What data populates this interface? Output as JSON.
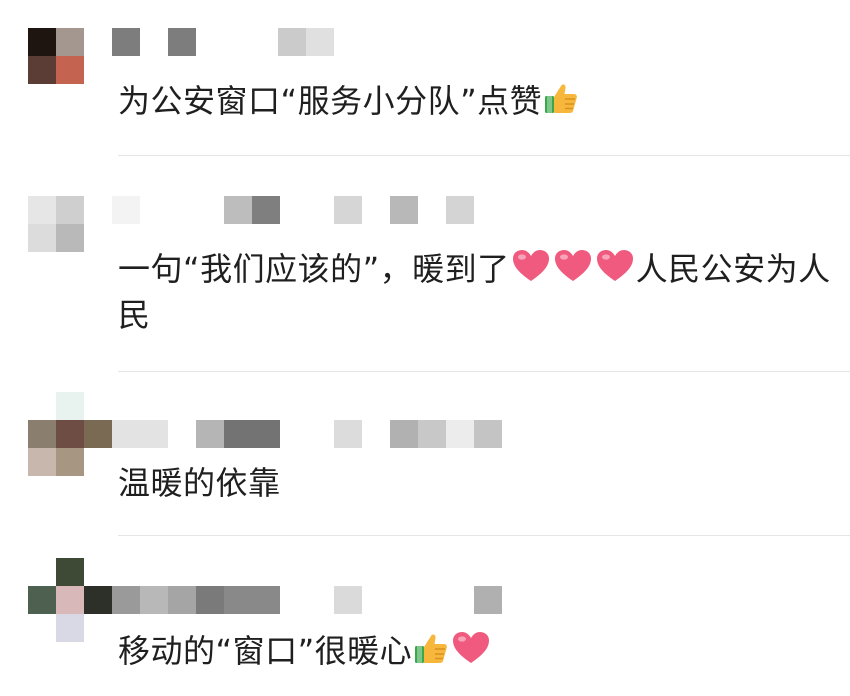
{
  "comments": [
    {
      "text_before": "为公安窗口“服务小分队”点赞",
      "text_after": "",
      "icons": [
        "thumbs-up-icon"
      ],
      "avatar_colors": [
        "#1e1410",
        "#a49790",
        "#5c3d36",
        "#c4634f"
      ],
      "username_blocks": [
        "#7d7d7d",
        "#7d7d7d",
        "#cbcbcb",
        "#e0e0e0"
      ]
    },
    {
      "text_before": "一句“我们应该的”，暖到了",
      "text_after": "人民公安为人民",
      "icons": [
        "heart-icon",
        "heart-icon",
        "heart-icon"
      ],
      "avatar_colors": [
        "#e6e6e6",
        "#cfcfcf",
        "#dcdcdc",
        "#b9b9b9"
      ],
      "username_blocks": [
        "#f3f3f3",
        "#bdbdbd",
        "#7f7f7f",
        "#d6d6d6",
        "#b8b8b8",
        "#d4d4d4"
      ]
    },
    {
      "text_before": "温暖的依靠",
      "text_after": "",
      "icons": [],
      "avatar_colors": [
        "#8a7f6f",
        "#6d4d44",
        "#7a6a54",
        "#c7b7ac",
        "#a79681",
        "#e8f2ef"
      ],
      "username_blocks": [
        "#e3e3e3",
        "#b5b5b5",
        "#737373",
        "#dcdcdc",
        "#b1b1b1",
        "#c8c8c8",
        "#ececec",
        "#c4c4c4"
      ]
    },
    {
      "text_before": "移动的“窗口”很暖心",
      "text_after": "",
      "icons": [
        "thumbs-up-icon",
        "heart-icon"
      ],
      "avatar_colors": [
        "#3f4a36",
        "#4e6050",
        "#d8b8b8",
        "#2c3028",
        "#d9d9e5"
      ],
      "username_blocks": [
        "#9a9a9a",
        "#b8b8b8",
        "#7a7a7a",
        "#898989",
        "#dadada",
        "#b0b0b0"
      ]
    }
  ],
  "colors": {
    "text": "#1f1f1f",
    "divider": "#e6e6e6",
    "heart": "#f05a7e",
    "thumb_skin": "#f6b73c",
    "thumb_cuff": "#3aa84a"
  }
}
